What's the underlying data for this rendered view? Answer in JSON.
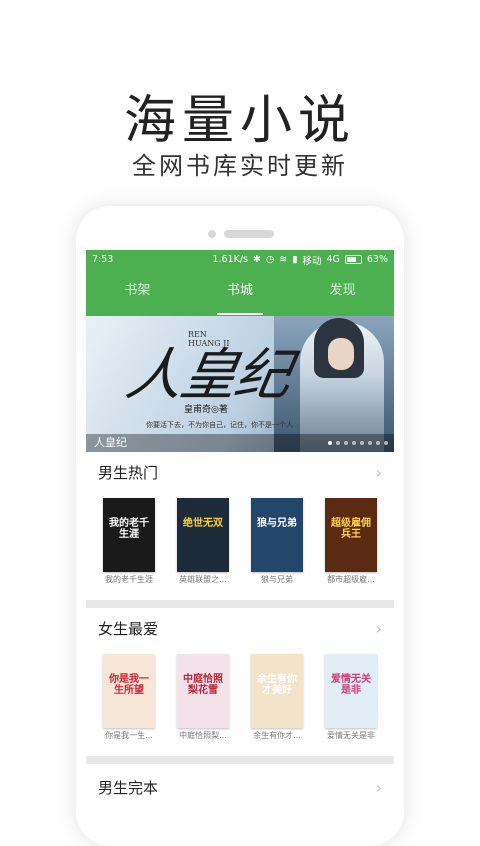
{
  "promo": {
    "title": "海量小说",
    "subtitle": "全网书库实时更新"
  },
  "status": {
    "time": "7:53",
    "speed": "1.61K/s",
    "carrier": "移动",
    "network": "4G",
    "battery": "63%"
  },
  "tabs": [
    "书架",
    "书城",
    "发现"
  ],
  "active_tab": "书城",
  "banner": {
    "caption": "人皇纪",
    "calligraphy": "人皇纪",
    "latin": "REN\nHUANG JI",
    "author": "皇甫奇◎著",
    "tagline": "你要活下去，不为你自己，记住，你不是一个人",
    "dots": 8
  },
  "sections": [
    {
      "title": "男生热门",
      "books": [
        {
          "name": "我的老千生涯",
          "cover_text": "我的老千生涯",
          "cover_color": "#1a1a1a",
          "text_color": "#ffffff"
        },
        {
          "name": "英雄联盟之...",
          "cover_text": "绝世无双",
          "cover_color": "#1e2c3a",
          "text_color": "#ffcc33"
        },
        {
          "name": "狼与兄弟",
          "cover_text": "狼与兄弟",
          "cover_color": "#23466b",
          "text_color": "#ffffff"
        },
        {
          "name": "都市超级雇...",
          "cover_text": "超级雇佣兵王",
          "cover_color": "#5a2a12",
          "text_color": "#ffd24a"
        }
      ]
    },
    {
      "title": "女生最爱",
      "books": [
        {
          "name": "你是我一生...",
          "cover_text": "你是我一生所望",
          "cover_color": "#f5e6d6",
          "text_color": "#d4213a"
        },
        {
          "name": "中庭恰照梨...",
          "cover_text": "中庭恰照梨花雪",
          "cover_color": "#f4e2ea",
          "text_color": "#b8283c"
        },
        {
          "name": "余生有你才...",
          "cover_text": "余生有你才美好",
          "cover_color": "#f1e4c8",
          "text_color": "#ffffff"
        },
        {
          "name": "爱情无关是非",
          "cover_text": "爱情无关是非",
          "cover_color": "#e2eef6",
          "text_color": "#d33b7d"
        }
      ]
    }
  ],
  "section3": {
    "title": "男生完本"
  }
}
